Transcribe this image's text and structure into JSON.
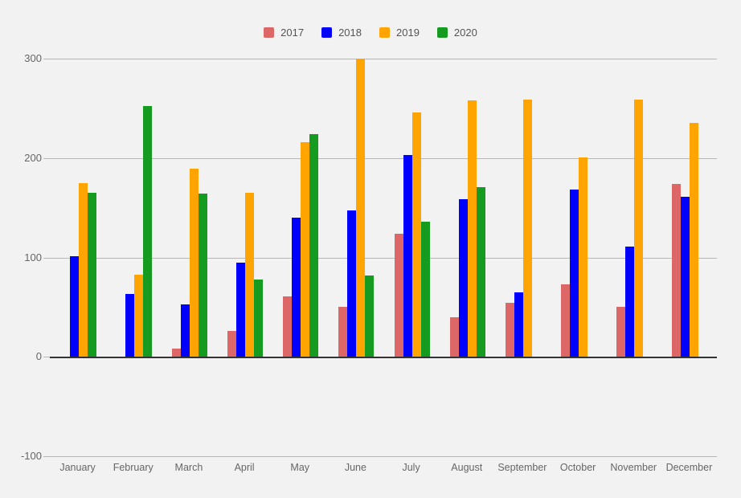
{
  "background_color": "#f2f2f2",
  "legend": {
    "position": "top-center",
    "items": [
      {
        "label": "2017",
        "color": "#dd6666"
      },
      {
        "label": "2018",
        "color": "#0000ff"
      },
      {
        "label": "2019",
        "color": "#ffa400"
      },
      {
        "label": "2020",
        "color": "#159b1f"
      }
    ]
  },
  "axes": {
    "y_ticks": [
      "300",
      "200",
      "100",
      "0",
      "-100"
    ],
    "y_tick_values": [
      300,
      200,
      100,
      0,
      -100
    ],
    "x_tick_labels": [
      "January",
      "February",
      "March",
      "April",
      "May",
      "June",
      "July",
      "August",
      "September",
      "October",
      "November",
      "December"
    ]
  },
  "chart_data": {
    "type": "bar",
    "title": "",
    "subtitle": "",
    "xlabel": "",
    "ylabel": "",
    "ylim": [
      -100,
      300
    ],
    "grid": true,
    "legend_position": "top-center",
    "categories": [
      "January",
      "February",
      "March",
      "April",
      "May",
      "June",
      "July",
      "August",
      "September",
      "October",
      "November",
      "December"
    ],
    "series": [
      {
        "name": "2017",
        "color": "#dd6666",
        "values": [
          0,
          0,
          8,
          26,
          61,
          50,
          124,
          40,
          54,
          73,
          50,
          174
        ]
      },
      {
        "name": "2018",
        "color": "#0000ff",
        "values": [
          101,
          63,
          53,
          95,
          140,
          147,
          203,
          159,
          65,
          168,
          111,
          161
        ]
      },
      {
        "name": "2019",
        "color": "#ffa400",
        "values": [
          175,
          83,
          189,
          165,
          216,
          300,
          246,
          258,
          259,
          201,
          259,
          235
        ]
      },
      {
        "name": "2020",
        "color": "#159b1f",
        "values": [
          165,
          252,
          164,
          78,
          224,
          82,
          136,
          171,
          0,
          0,
          0,
          0
        ]
      }
    ]
  }
}
